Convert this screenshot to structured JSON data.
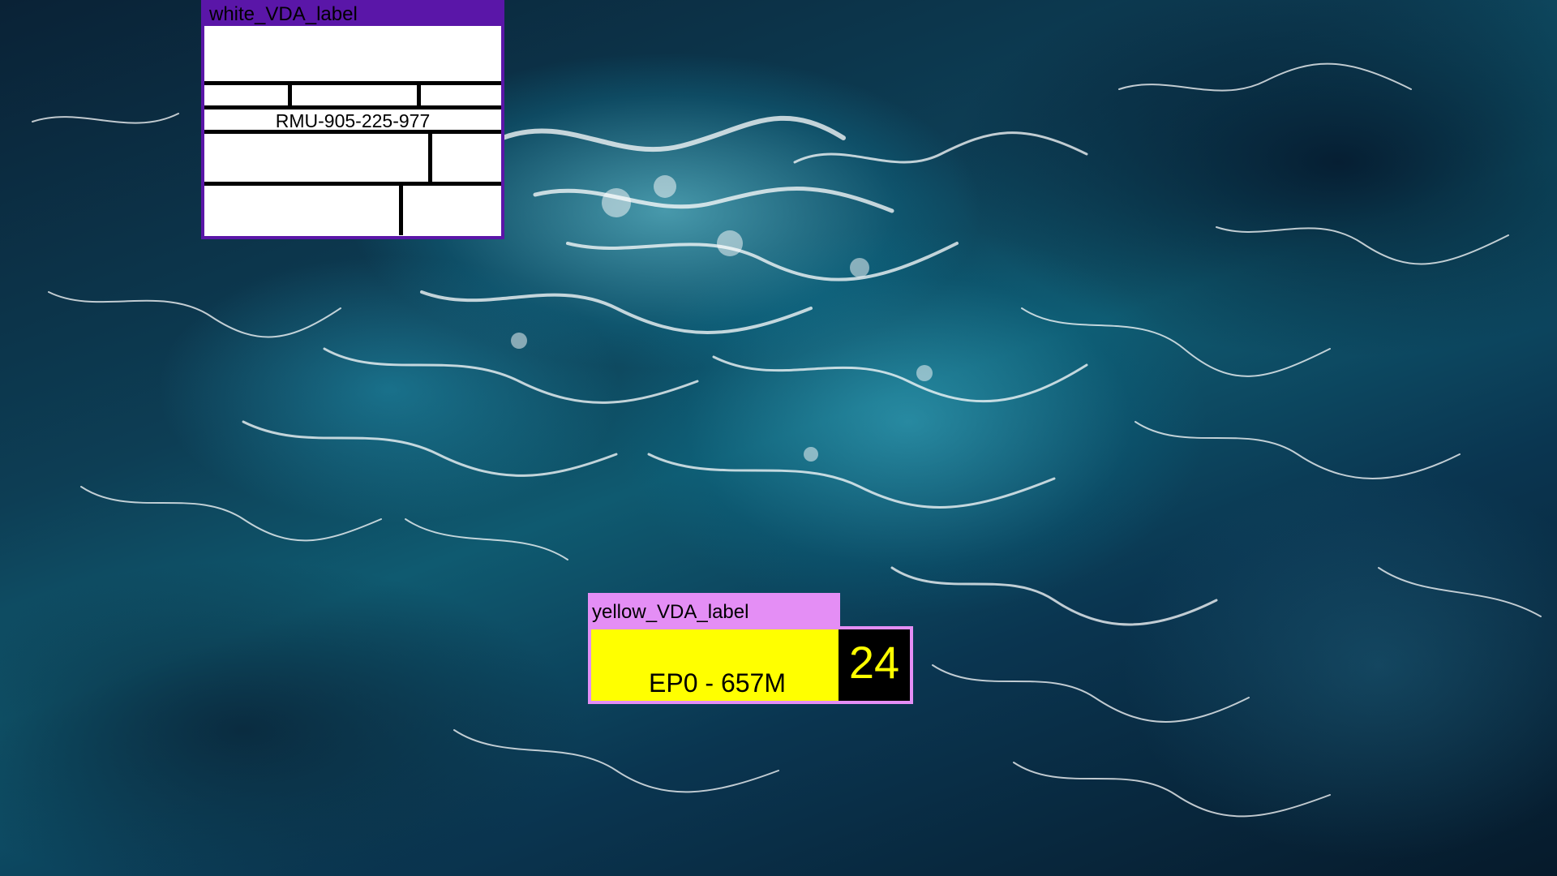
{
  "background": {
    "description_icon": "ocean-waves-background",
    "colors": {
      "deep": "#061a2b",
      "mid": "#0f5a70",
      "bright": "#6fe0f0",
      "foam": "#ffffff"
    }
  },
  "white_label": {
    "title": "white_VDA_label",
    "code": "RMU-905-225-977",
    "colors": {
      "border": "#5a16a8",
      "header": "#5a16a8",
      "body": "#ffffff"
    }
  },
  "yellow_label": {
    "title": "yellow_VDA_label",
    "text": "EP0 - 657M",
    "number": "24",
    "colors": {
      "header": "#e48ef5",
      "body": "#ffff00",
      "number_bg": "#000000",
      "number_fg": "#ffff00"
    }
  }
}
